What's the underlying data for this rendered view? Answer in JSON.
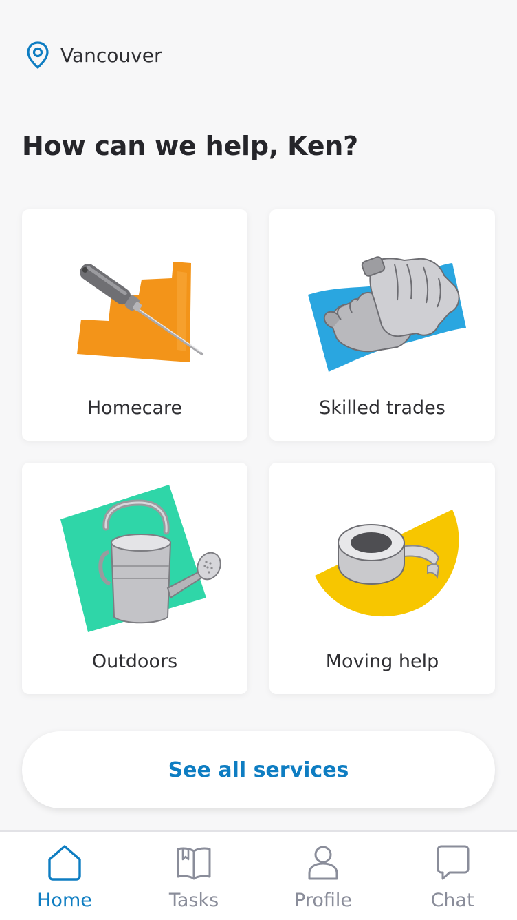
{
  "location": {
    "icon": "location-pin-icon",
    "city": "Vancouver"
  },
  "greeting": "How can we help, Ken?",
  "categories": [
    {
      "label": "Homecare",
      "icon": "screwdriver-icon",
      "accent": "#f39419"
    },
    {
      "label": "Skilled trades",
      "icon": "work-gloves-icon",
      "accent": "#2aa6e0"
    },
    {
      "label": "Outdoors",
      "icon": "watering-can-icon",
      "accent": "#2fd6a8"
    },
    {
      "label": "Moving help",
      "icon": "packing-tape-icon",
      "accent": "#f7c600"
    }
  ],
  "see_all_label": "See all services",
  "tabs": [
    {
      "label": "Home",
      "icon": "home-icon",
      "active": true
    },
    {
      "label": "Tasks",
      "icon": "book-icon",
      "active": false
    },
    {
      "label": "Profile",
      "icon": "person-icon",
      "active": false
    },
    {
      "label": "Chat",
      "icon": "chat-bubble-icon",
      "active": false
    }
  ],
  "colors": {
    "brand_blue": "#0e7dc2",
    "tab_inactive": "#8a8d9a",
    "background": "#f7f7f8"
  }
}
